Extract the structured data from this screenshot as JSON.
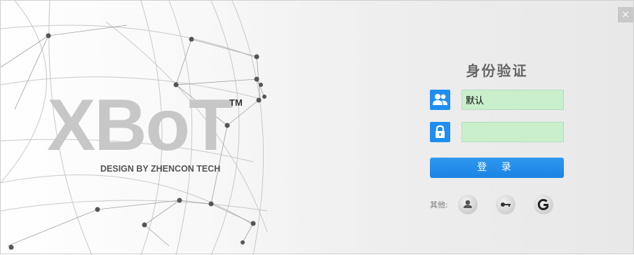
{
  "window": {
    "close_label": "×"
  },
  "brand": {
    "logo": "XBoT",
    "trademark": "TM",
    "tagline": "DESIGN BY ZHENCON TECH"
  },
  "login": {
    "title": "身份验证",
    "username_value": "默认",
    "password_value": "",
    "submit_label": "登 录",
    "other_label": "其他:"
  },
  "alt_login": [
    {
      "icon": "user-avatar-icon"
    },
    {
      "icon": "key-icon"
    },
    {
      "icon": "power-icon"
    }
  ],
  "colors": {
    "accent": "#1f8ef0",
    "field_bg": "#c9efcc",
    "logo_gray": "#c7c7c7"
  }
}
